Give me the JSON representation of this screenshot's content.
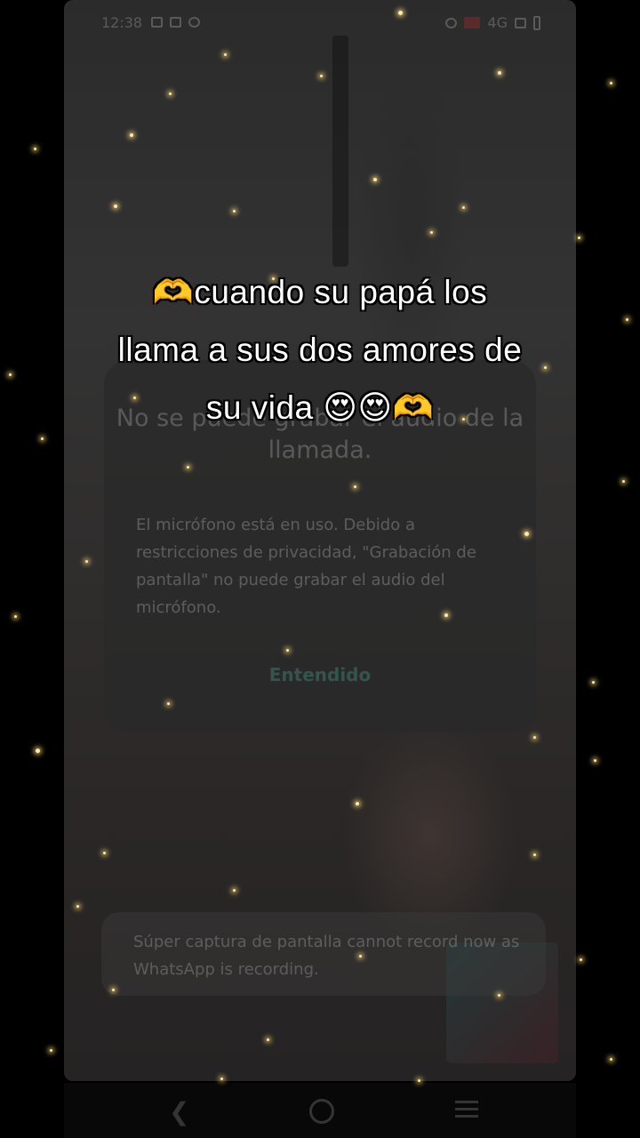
{
  "status_bar": {
    "time": "12:38",
    "network": "4G"
  },
  "dialog": {
    "title": "No se puede grabar el audio de la llamada.",
    "body": "El micrófono está en uso. Debido a restricciones de privacidad, \"Grabación de pantalla\" no puede grabar el audio del micrófono.",
    "button": "Entendido"
  },
  "toast": {
    "text": "Súper captura de pantalla cannot record now as WhatsApp is recording."
  },
  "caption": {
    "line1": "🫶cuando su papá los",
    "line2": "llama a sus dos amores de",
    "line3": "su vida 😍😍🫶"
  },
  "navigation": {
    "back_icon": "back-icon",
    "home_icon": "home-icon",
    "menu_icon": "menu-icon"
  },
  "colors": {
    "sparkle": "#ffe9a8",
    "caption_text": "#ffffff",
    "dialog_button": "#3c8c78"
  }
}
